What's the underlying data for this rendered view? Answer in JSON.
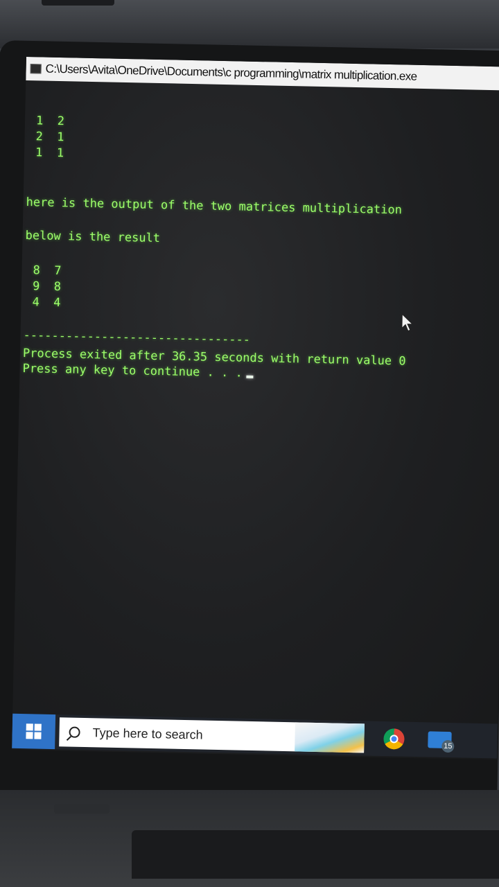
{
  "window": {
    "title": "C:\\Users\\Avita\\OneDrive\\Documents\\c programming\\matrix multiplication.exe"
  },
  "console": {
    "matrix_rows": [
      "1  2",
      "2  1",
      "1  1"
    ],
    "output_heading": "here is the output of the two matrices multiplication",
    "result_heading": "below is the result",
    "result_rows": [
      "8  7",
      "9  8",
      "4  4"
    ],
    "separator": "--------------------------------",
    "process_exit": "Process exited after 36.35 seconds with return value 0",
    "press_key": "Press any key to continue . . ."
  },
  "taskbar": {
    "search_placeholder": "Type here to search",
    "mail_badge": "15"
  },
  "colors": {
    "console_text": "#9dff6a",
    "taskbar_bg": "#20242b",
    "start_button": "#2f73c7"
  },
  "icons": {
    "start": "windows-icon",
    "search": "search-icon",
    "browser": "chrome-icon",
    "mail": "mail-icon",
    "cursor": "mouse-pointer-icon"
  }
}
